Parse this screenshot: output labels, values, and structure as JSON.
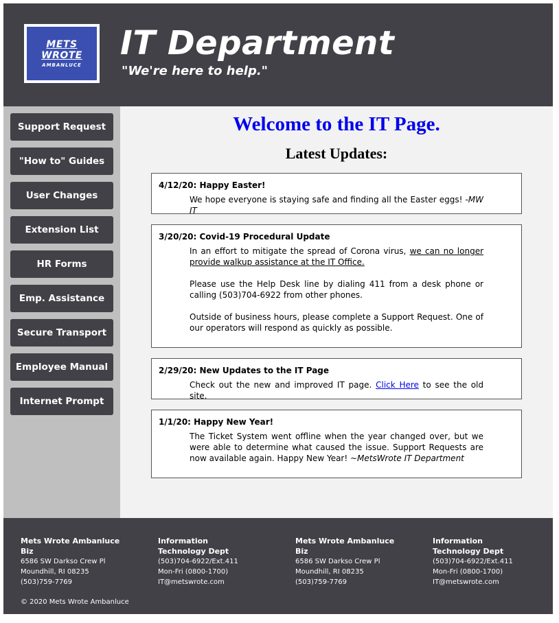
{
  "header": {
    "logo": {
      "line1": "METS",
      "line2": "WROTE",
      "line3": "AMBANLUCE"
    },
    "title": "IT Department",
    "tagline": "\"We're here to help.\""
  },
  "sidebar": {
    "items": [
      {
        "label": "Support Request"
      },
      {
        "label": "\"How to\" Guides"
      },
      {
        "label": "User Changes"
      },
      {
        "label": "Extension List"
      },
      {
        "label": "HR Forms"
      },
      {
        "label": "Emp. Assistance"
      },
      {
        "label": "Secure Transport"
      },
      {
        "label": "Employee Manual"
      },
      {
        "label": "Internet Prompt"
      }
    ]
  },
  "main": {
    "welcome": "Welcome to the IT Page.",
    "updates_title": "Latest Updates:",
    "posts": [
      {
        "title": "4/12/20: Happy Easter!",
        "body_text": "We hope everyone is staying safe and finding all the Easter eggs! ",
        "signature": "-MW IT"
      },
      {
        "title": "3/20/20: Covid-19 Procedural Update",
        "p1_text": "In an effort to mitigate the spread of Corona virus, ",
        "p1_underlined": "we can no longer provide walkup assistance at the IT Office.",
        "p2": "Please use the Help Desk line by dialing 411 from a desk phone or calling (503)704-6922 from other phones.",
        "p3": "Outside of business hours, please complete a Support Request. One of our operators will respond as quickly as possible."
      },
      {
        "title": "2/29/20: New Updates to the IT Page",
        "body_pre": "Check out the new and improved IT page. ",
        "link": "Click Here",
        "body_post": " to see the old site."
      },
      {
        "title": "1/1/20: Happy New Year!",
        "body_text": "The Ticket System went offline when the year changed over, but we were able to determine what caused the issue. Support Requests are now available again. Happy New Year! ",
        "signature": "~MetsWrote IT Department"
      }
    ]
  },
  "footer": {
    "columns": [
      {
        "heading": "Mets Wrote Ambanluce Biz",
        "lines": [
          "6586 SW Darkso Crew Pl",
          "Moundhill, RI 08235",
          "(503)759-7769"
        ]
      },
      {
        "heading": "Information Technology Dept",
        "lines": [
          "(503)704-6922/Ext.411",
          "Mon-Fri (0800-1700)",
          "IT@metswrote.com"
        ]
      },
      {
        "heading": "Mets Wrote Ambanluce Biz",
        "lines": [
          "6586 SW Darkso Crew Pl",
          "Moundhill, RI 08235",
          "(503)759-7769"
        ]
      },
      {
        "heading": "Information Technology Dept",
        "lines": [
          "(503)704-6922/Ext.411",
          "Mon-Fri (0800-1700)",
          "IT@metswrote.com"
        ]
      }
    ],
    "copyright": "© 2020 Mets Wrote Ambanluce"
  },
  "colors": {
    "header_bg": "#414147",
    "sidebar_bg": "#bfbfbf",
    "main_bg": "#f2f2f2",
    "logo_blue": "#3a4fb0",
    "welcome_blue": "#0000ee"
  }
}
